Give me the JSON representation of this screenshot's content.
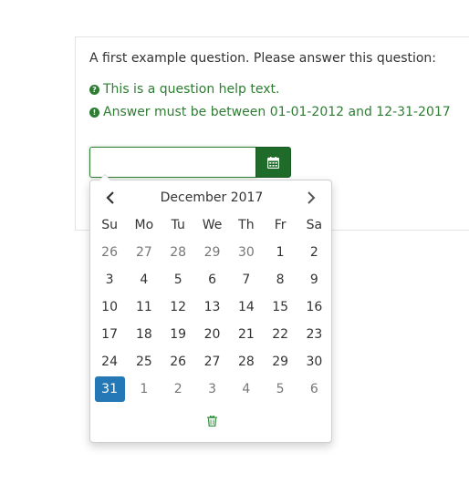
{
  "question": {
    "text": "A first example question. Please answer this question:",
    "help_text": "This is a question help text.",
    "validation_text": "Answer must be between 01-01-2012 and 12-31-2017"
  },
  "input": {
    "value": "",
    "placeholder": ""
  },
  "datepicker": {
    "title": "December 2017",
    "weekdays": [
      "Su",
      "Mo",
      "Tu",
      "We",
      "Th",
      "Fr",
      "Sa"
    ],
    "weeks": [
      [
        "26",
        "27",
        "28",
        "29",
        "30",
        "1",
        "2"
      ],
      [
        "3",
        "4",
        "5",
        "6",
        "7",
        "8",
        "9"
      ],
      [
        "10",
        "11",
        "12",
        "13",
        "14",
        "15",
        "16"
      ],
      [
        "17",
        "18",
        "19",
        "20",
        "21",
        "22",
        "23"
      ],
      [
        "24",
        "25",
        "26",
        "27",
        "28",
        "29",
        "30"
      ],
      [
        "31",
        "1",
        "2",
        "3",
        "4",
        "5",
        "6"
      ]
    ],
    "selected": "31"
  },
  "icons": {
    "help": "question-circle-icon",
    "validation": "exclamation-circle-icon",
    "calendar": "calendar-icon",
    "prev": "chevron-left-icon",
    "next": "chevron-right-icon",
    "clear": "trash-icon"
  },
  "colors": {
    "help_green": "#2e7d32",
    "button_green": "#1f6b2a",
    "selected_blue": "#2378b5"
  }
}
